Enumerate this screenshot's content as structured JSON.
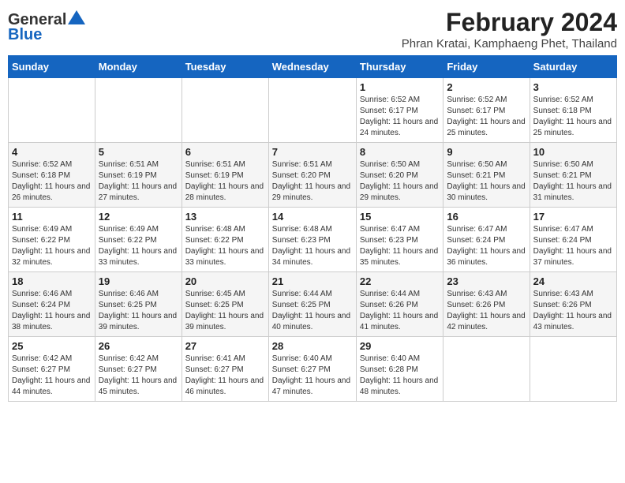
{
  "header": {
    "logo_general": "General",
    "logo_blue": "Blue",
    "title": "February 2024",
    "subtitle": "Phran Kratai, Kamphaeng Phet, Thailand"
  },
  "weekdays": [
    "Sunday",
    "Monday",
    "Tuesday",
    "Wednesday",
    "Thursday",
    "Friday",
    "Saturday"
  ],
  "weeks": [
    [
      {
        "day": "",
        "info": ""
      },
      {
        "day": "",
        "info": ""
      },
      {
        "day": "",
        "info": ""
      },
      {
        "day": "",
        "info": ""
      },
      {
        "day": "1",
        "info": "Sunrise: 6:52 AM\nSunset: 6:17 PM\nDaylight: 11 hours and 24 minutes."
      },
      {
        "day": "2",
        "info": "Sunrise: 6:52 AM\nSunset: 6:17 PM\nDaylight: 11 hours and 25 minutes."
      },
      {
        "day": "3",
        "info": "Sunrise: 6:52 AM\nSunset: 6:18 PM\nDaylight: 11 hours and 25 minutes."
      }
    ],
    [
      {
        "day": "4",
        "info": "Sunrise: 6:52 AM\nSunset: 6:18 PM\nDaylight: 11 hours and 26 minutes."
      },
      {
        "day": "5",
        "info": "Sunrise: 6:51 AM\nSunset: 6:19 PM\nDaylight: 11 hours and 27 minutes."
      },
      {
        "day": "6",
        "info": "Sunrise: 6:51 AM\nSunset: 6:19 PM\nDaylight: 11 hours and 28 minutes."
      },
      {
        "day": "7",
        "info": "Sunrise: 6:51 AM\nSunset: 6:20 PM\nDaylight: 11 hours and 29 minutes."
      },
      {
        "day": "8",
        "info": "Sunrise: 6:50 AM\nSunset: 6:20 PM\nDaylight: 11 hours and 29 minutes."
      },
      {
        "day": "9",
        "info": "Sunrise: 6:50 AM\nSunset: 6:21 PM\nDaylight: 11 hours and 30 minutes."
      },
      {
        "day": "10",
        "info": "Sunrise: 6:50 AM\nSunset: 6:21 PM\nDaylight: 11 hours and 31 minutes."
      }
    ],
    [
      {
        "day": "11",
        "info": "Sunrise: 6:49 AM\nSunset: 6:22 PM\nDaylight: 11 hours and 32 minutes."
      },
      {
        "day": "12",
        "info": "Sunrise: 6:49 AM\nSunset: 6:22 PM\nDaylight: 11 hours and 33 minutes."
      },
      {
        "day": "13",
        "info": "Sunrise: 6:48 AM\nSunset: 6:22 PM\nDaylight: 11 hours and 33 minutes."
      },
      {
        "day": "14",
        "info": "Sunrise: 6:48 AM\nSunset: 6:23 PM\nDaylight: 11 hours and 34 minutes."
      },
      {
        "day": "15",
        "info": "Sunrise: 6:47 AM\nSunset: 6:23 PM\nDaylight: 11 hours and 35 minutes."
      },
      {
        "day": "16",
        "info": "Sunrise: 6:47 AM\nSunset: 6:24 PM\nDaylight: 11 hours and 36 minutes."
      },
      {
        "day": "17",
        "info": "Sunrise: 6:47 AM\nSunset: 6:24 PM\nDaylight: 11 hours and 37 minutes."
      }
    ],
    [
      {
        "day": "18",
        "info": "Sunrise: 6:46 AM\nSunset: 6:24 PM\nDaylight: 11 hours and 38 minutes."
      },
      {
        "day": "19",
        "info": "Sunrise: 6:46 AM\nSunset: 6:25 PM\nDaylight: 11 hours and 39 minutes."
      },
      {
        "day": "20",
        "info": "Sunrise: 6:45 AM\nSunset: 6:25 PM\nDaylight: 11 hours and 39 minutes."
      },
      {
        "day": "21",
        "info": "Sunrise: 6:44 AM\nSunset: 6:25 PM\nDaylight: 11 hours and 40 minutes."
      },
      {
        "day": "22",
        "info": "Sunrise: 6:44 AM\nSunset: 6:26 PM\nDaylight: 11 hours and 41 minutes."
      },
      {
        "day": "23",
        "info": "Sunrise: 6:43 AM\nSunset: 6:26 PM\nDaylight: 11 hours and 42 minutes."
      },
      {
        "day": "24",
        "info": "Sunrise: 6:43 AM\nSunset: 6:26 PM\nDaylight: 11 hours and 43 minutes."
      }
    ],
    [
      {
        "day": "25",
        "info": "Sunrise: 6:42 AM\nSunset: 6:27 PM\nDaylight: 11 hours and 44 minutes."
      },
      {
        "day": "26",
        "info": "Sunrise: 6:42 AM\nSunset: 6:27 PM\nDaylight: 11 hours and 45 minutes."
      },
      {
        "day": "27",
        "info": "Sunrise: 6:41 AM\nSunset: 6:27 PM\nDaylight: 11 hours and 46 minutes."
      },
      {
        "day": "28",
        "info": "Sunrise: 6:40 AM\nSunset: 6:27 PM\nDaylight: 11 hours and 47 minutes."
      },
      {
        "day": "29",
        "info": "Sunrise: 6:40 AM\nSunset: 6:28 PM\nDaylight: 11 hours and 48 minutes."
      },
      {
        "day": "",
        "info": ""
      },
      {
        "day": "",
        "info": ""
      }
    ]
  ]
}
